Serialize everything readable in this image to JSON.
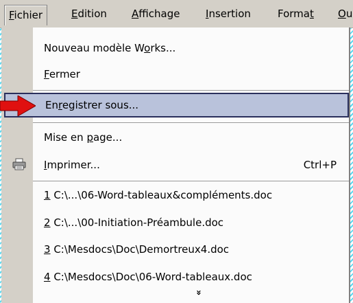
{
  "menubar": {
    "items": [
      {
        "label": "Fichier",
        "accel_index": 0
      },
      {
        "label": "Edition",
        "accel_index": 0
      },
      {
        "label": "Affichage",
        "accel_index": 0
      },
      {
        "label": "Insertion",
        "accel_index": 0
      },
      {
        "label": "Format",
        "accel_index": 5
      },
      {
        "label": "Ou",
        "accel_index": 0
      }
    ]
  },
  "menu": {
    "items": [
      {
        "label": "Nouveau modèle Works...",
        "accel_index": 16
      },
      {
        "label": "Fermer",
        "accel_index": 0
      },
      {
        "label": "Enregistrer sous...",
        "accel_index": 2,
        "highlighted": true
      },
      {
        "label": "Mise en page...",
        "accel_index": 8
      },
      {
        "label": "Imprimer...",
        "accel_index": 0,
        "shortcut": "Ctrl+P",
        "icon": "printer-icon"
      },
      {
        "label": "1 C:\\...\\06-Word-tableaux&compléments.doc",
        "accel_index": 0
      },
      {
        "label": "2 C:\\...\\00-Initiation-Préambule.doc",
        "accel_index": 0
      },
      {
        "label": "3 C:\\Mesdocs\\Doc\\Demortreux4.doc",
        "accel_index": 0
      },
      {
        "label": "4 C:\\Mesdocs\\Doc\\06-Word-tableaux.doc",
        "accel_index": 0
      }
    ],
    "expand_icon": "double-chevron-down-icon"
  },
  "colors": {
    "menubar_bg": "#d4d0c8",
    "highlight_bg": "#b9c2db",
    "highlight_border": "#2a2f5c",
    "pointer_arrow": "#e01010",
    "background_stripes": "#5ad8f0"
  }
}
